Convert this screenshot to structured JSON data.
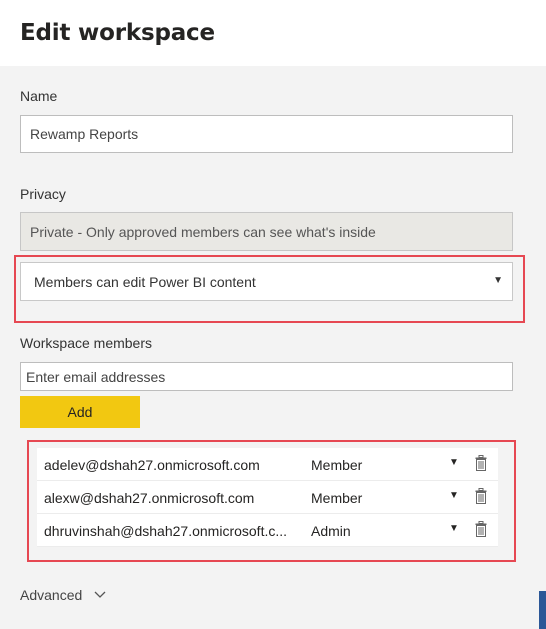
{
  "header": {
    "title": "Edit workspace"
  },
  "name": {
    "label": "Name",
    "value": "Rewamp Reports"
  },
  "privacy": {
    "label": "Privacy",
    "value": "Private - Only approved members can see what's inside",
    "permission_value": "Members can edit Power BI content"
  },
  "members_section": {
    "label": "Workspace members",
    "email_placeholder": "Enter email addresses",
    "add_label": "Add"
  },
  "members": [
    {
      "email": "adelev@dshah27.onmicrosoft.com",
      "role": "Member"
    },
    {
      "email": "alexw@dshah27.onmicrosoft.com",
      "role": "Member"
    },
    {
      "email": "dhruvinshah@dshah27.onmicrosoft.c...",
      "role": "Admin"
    }
  ],
  "advanced": {
    "label": "Advanced"
  },
  "colors": {
    "highlight": "#e64852",
    "accent": "#f2c811"
  },
  "icons": {
    "dropdown": "caret-down-icon",
    "delete": "trash-icon",
    "expand": "chevron-down-icon"
  }
}
